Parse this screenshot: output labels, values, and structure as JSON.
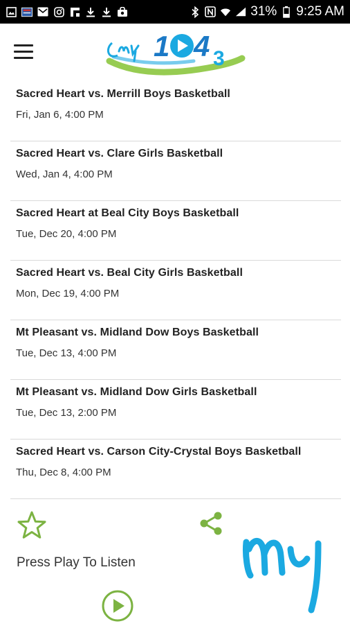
{
  "status_bar": {
    "battery": "31%",
    "time": "9:25 AM",
    "icons": [
      "gallery-icon",
      "news-icon",
      "mail-icon",
      "instagram-icon",
      "flipboard-icon",
      "download-icon",
      "download-icon",
      "bag-icon",
      "bluetooth-icon",
      "nfc-icon",
      "wifi-icon",
      "signal-icon",
      "battery-icon"
    ]
  },
  "header": {
    "logo_text": "my 104 3",
    "menu_icon": "hamburger-icon"
  },
  "events": [
    {
      "title": "Sacred Heart vs. Merrill Boys Basketball",
      "date": "Fri, Jan 6, 4:00 PM"
    },
    {
      "title": "Sacred Heart vs. Clare Girls Basketball",
      "date": "Wed, Jan 4, 4:00 PM"
    },
    {
      "title": "Sacred Heart at Beal City Boys Basketball",
      "date": "Tue, Dec 20, 4:00 PM"
    },
    {
      "title": "Sacred Heart vs. Beal City Girls Basketball",
      "date": "Mon, Dec 19, 4:00 PM"
    },
    {
      "title": "Mt Pleasant vs. Midland Dow Boys Basketball",
      "date": "Tue, Dec 13, 4:00 PM"
    },
    {
      "title": "Mt Pleasant vs. Midland Dow Girls Basketball",
      "date": "Tue, Dec 13, 2:00 PM"
    },
    {
      "title": "Sacred Heart vs. Carson City-Crystal Boys Basketball",
      "date": "Thu, Dec 8, 4:00 PM"
    }
  ],
  "player": {
    "listen_label": "Press Play To Listen",
    "logo_text": "my",
    "icons": [
      "star-icon",
      "share-icon",
      "play-icon"
    ]
  },
  "colors": {
    "accent_green": "#7cb342",
    "brand_blue": "#1ba9e1",
    "status_bar_bg": "#000000"
  }
}
